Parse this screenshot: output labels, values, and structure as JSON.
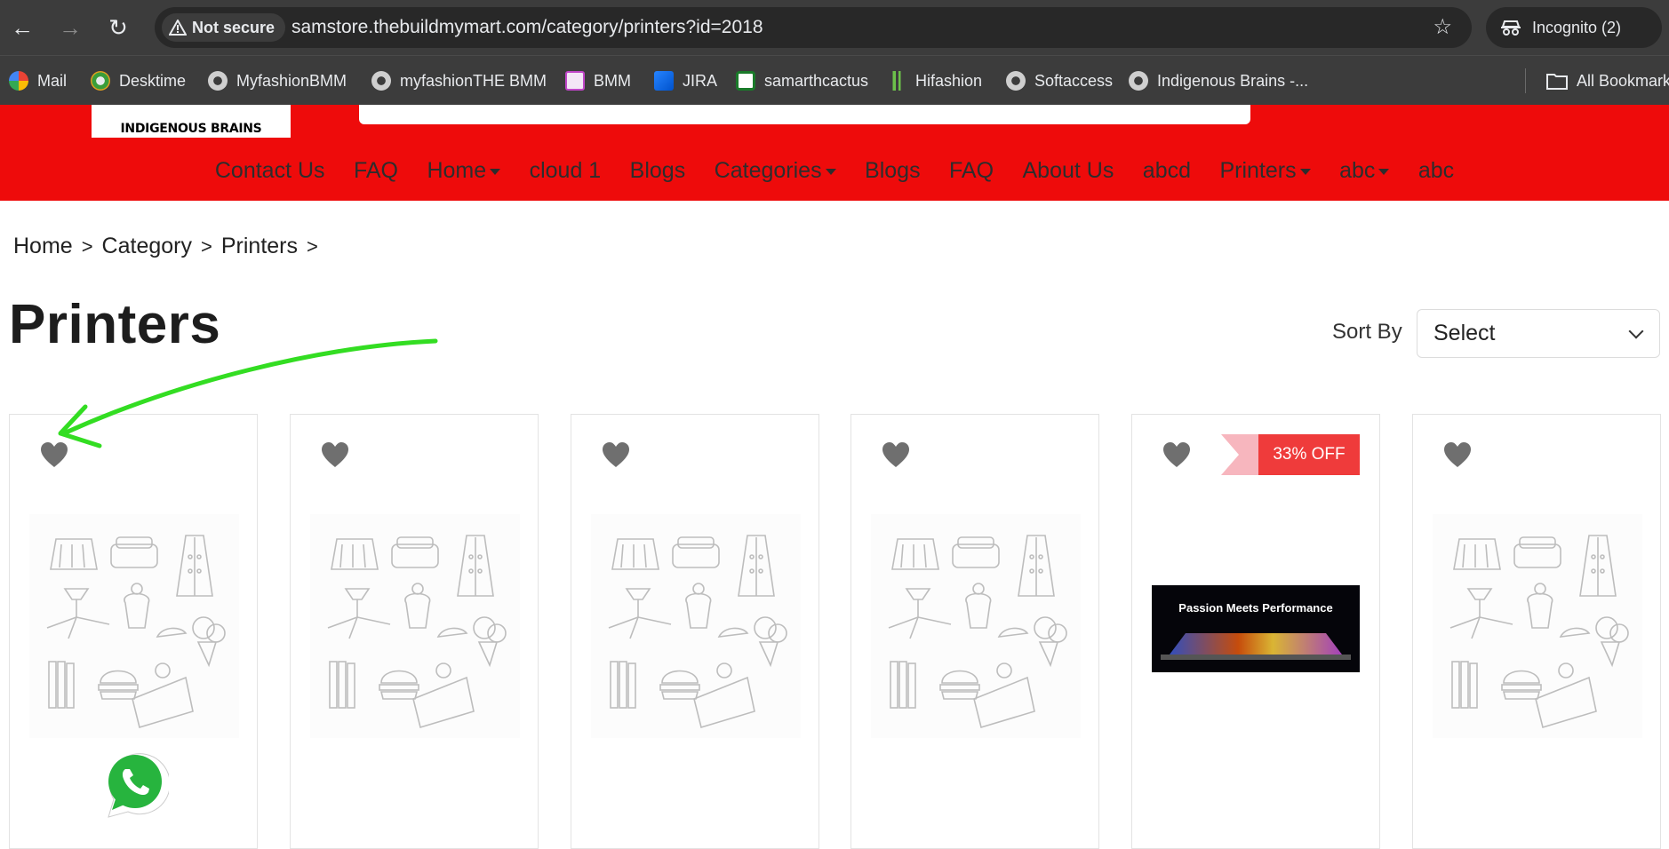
{
  "browser": {
    "security_label": "Not secure",
    "url": "samstore.thebuildmymart.com/category/printers?id=2018",
    "incognito_label": "Incognito (2)"
  },
  "bookmarks": [
    {
      "label": "Mail",
      "icon": "google-icon"
    },
    {
      "label": "Desktime",
      "icon": "desktime-icon"
    },
    {
      "label": "MyfashionBMM",
      "icon": "globe-icon"
    },
    {
      "label": "myfashionTHE BMM",
      "icon": "globe-icon"
    },
    {
      "label": "BMM",
      "icon": "bmm-icon"
    },
    {
      "label": "JIRA",
      "icon": "jira-icon"
    },
    {
      "label": "samarthcactus",
      "icon": "cactus-icon"
    },
    {
      "label": "Hifashion",
      "icon": "hifashion-icon"
    },
    {
      "label": "Softaccess",
      "icon": "globe-icon"
    },
    {
      "label": "Indigenous Brains -...",
      "icon": "globe-icon"
    }
  ],
  "all_bookmarks_label": "All Bookmarks",
  "site": {
    "logo_text": "INDIGENOUS BRAINS",
    "header_color": "#ee0b0b",
    "nav": [
      {
        "label": "Contact Us",
        "dropdown": false
      },
      {
        "label": "FAQ",
        "dropdown": false
      },
      {
        "label": "Home",
        "dropdown": true
      },
      {
        "label": "cloud 1",
        "dropdown": false
      },
      {
        "label": "Blogs",
        "dropdown": false
      },
      {
        "label": "Categories",
        "dropdown": true
      },
      {
        "label": "Blogs",
        "dropdown": false
      },
      {
        "label": "FAQ",
        "dropdown": false
      },
      {
        "label": "About Us",
        "dropdown": false
      },
      {
        "label": "abcd",
        "dropdown": false
      },
      {
        "label": "Printers",
        "dropdown": true
      },
      {
        "label": "abc",
        "dropdown": true
      },
      {
        "label": "abc",
        "dropdown": false
      }
    ]
  },
  "breadcrumb": {
    "home": "Home",
    "category": "Category",
    "current": "Printers",
    "separator": ">"
  },
  "page": {
    "title": "Printers",
    "sort_label": "Sort By",
    "sort_value": "Select"
  },
  "products": [
    {
      "image": "placeholder-illustration"
    },
    {
      "image": "placeholder-illustration"
    },
    {
      "image": "placeholder-illustration"
    },
    {
      "image": "placeholder-illustration"
    },
    {
      "image": "banner",
      "badge": "33% OFF",
      "banner_text": "Passion Meets Performance"
    },
    {
      "image": "placeholder-illustration"
    }
  ]
}
